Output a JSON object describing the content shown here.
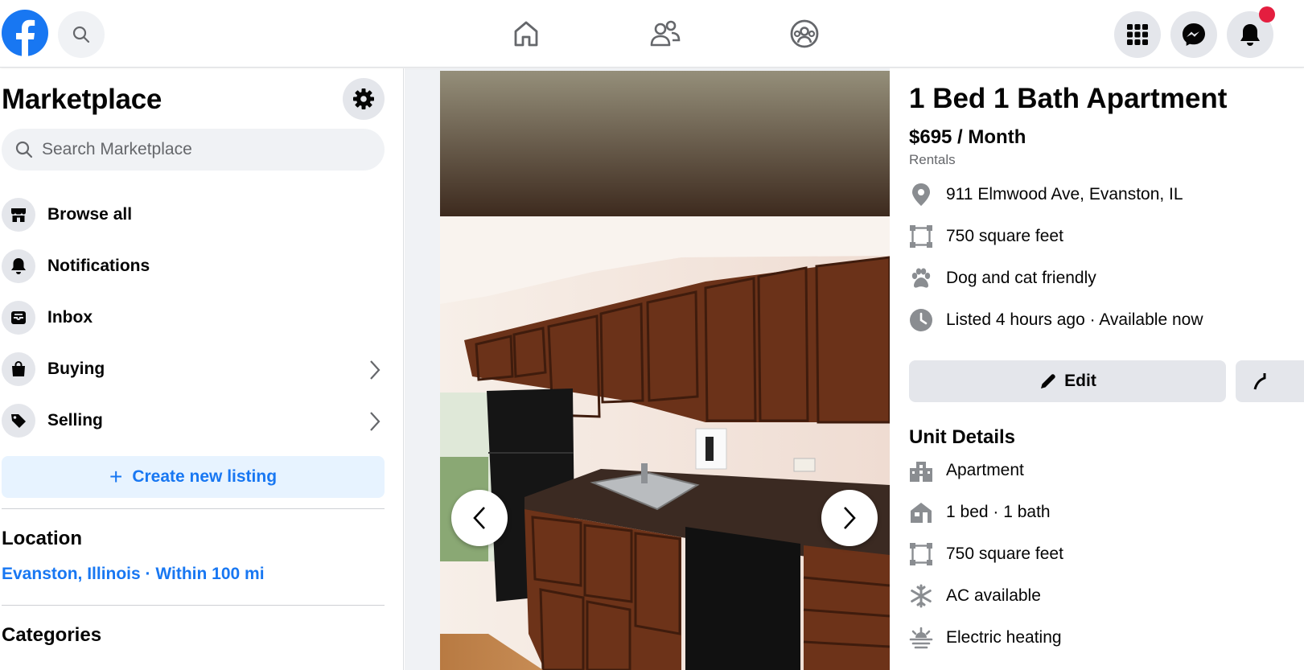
{
  "topbar": {
    "icons": [
      "facebook-logo",
      "search-icon",
      "home-icon",
      "friends-icon",
      "groups-icon",
      "menu-grid-icon",
      "messenger-icon",
      "bell-icon"
    ]
  },
  "sidebar": {
    "title": "Marketplace",
    "search_placeholder": "Search Marketplace",
    "items": [
      {
        "label": "Browse all",
        "icon": "storefront-icon"
      },
      {
        "label": "Notifications",
        "icon": "bell-icon"
      },
      {
        "label": "Inbox",
        "icon": "inbox-icon"
      },
      {
        "label": "Buying",
        "icon": "shopping-bag-icon"
      },
      {
        "label": "Selling",
        "icon": "price-tag-icon"
      }
    ],
    "create_label": "Create new listing",
    "location_heading": "Location",
    "location_value": "Evanston, Illinois · Within 100 mi",
    "categories_heading": "Categories"
  },
  "listing": {
    "title": "1 Bed 1 Bath Apartment",
    "price": "$695 / Month",
    "category": "Rentals",
    "facts": [
      {
        "text": "911 Elmwood Ave, Evanston, IL",
        "icon": "location-pin-icon"
      },
      {
        "text": "750 square feet",
        "icon": "area-icon"
      },
      {
        "text": "Dog and cat friendly",
        "icon": "paw-icon"
      },
      {
        "text": "Listed 4 hours ago · Available now",
        "icon": "clock-icon"
      }
    ],
    "edit_label": "Edit",
    "unit_details_heading": "Unit Details",
    "unit_details": [
      {
        "text": "Apartment",
        "icon": "building-icon"
      },
      {
        "text": "1 bed · 1 bath",
        "icon": "house-icon"
      },
      {
        "text": "750 square feet",
        "icon": "area-icon"
      },
      {
        "text": "AC available",
        "icon": "snowflake-icon"
      },
      {
        "text": "Electric heating",
        "icon": "heating-icon"
      }
    ]
  },
  "colors": {
    "accent": "#1877f2",
    "notification_badge": "#e41e3f",
    "icon_gray": "#65676b"
  }
}
